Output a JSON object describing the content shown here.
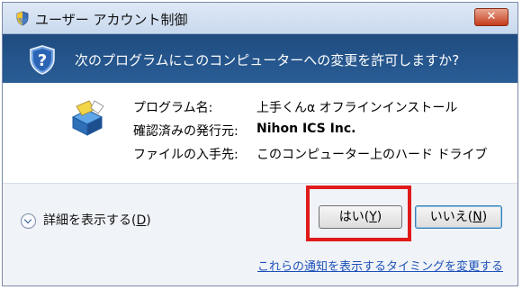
{
  "window": {
    "title": "ユーザー アカウント制御",
    "close_glyph": "✕"
  },
  "header": {
    "question": "次のプログラムにこのコンピューターへの変更を許可しますか?"
  },
  "details": {
    "program_name_label": "プログラム名:",
    "program_name_value": "上手くんα オフラインインストール",
    "publisher_label": "確認済みの発行元:",
    "publisher_value": "Nihon ICS Inc.",
    "file_origin_label": "ファイルの入手先:",
    "file_origin_value": "このコンピューター上のハード ドライブ"
  },
  "footer": {
    "show_details_label": "詳細を表示する(",
    "show_details_key": "D",
    "show_details_close": ")",
    "yes_label": "はい(",
    "yes_key": "Y",
    "yes_close": ")",
    "no_label": "いいえ(",
    "no_key": "N",
    "no_close": ")",
    "change_link": "これらの通知を表示するタイミングを変更する"
  },
  "colors": {
    "header_band": "#2a5d96",
    "link": "#1d51b8",
    "highlight_box": "#e01b1b"
  },
  "icons": {
    "title_icon": "uac-shield-icon",
    "header_icon": "help-shield-icon",
    "app_icon": "installer-box-icon",
    "expand_icon": "chevron-down-icon"
  }
}
